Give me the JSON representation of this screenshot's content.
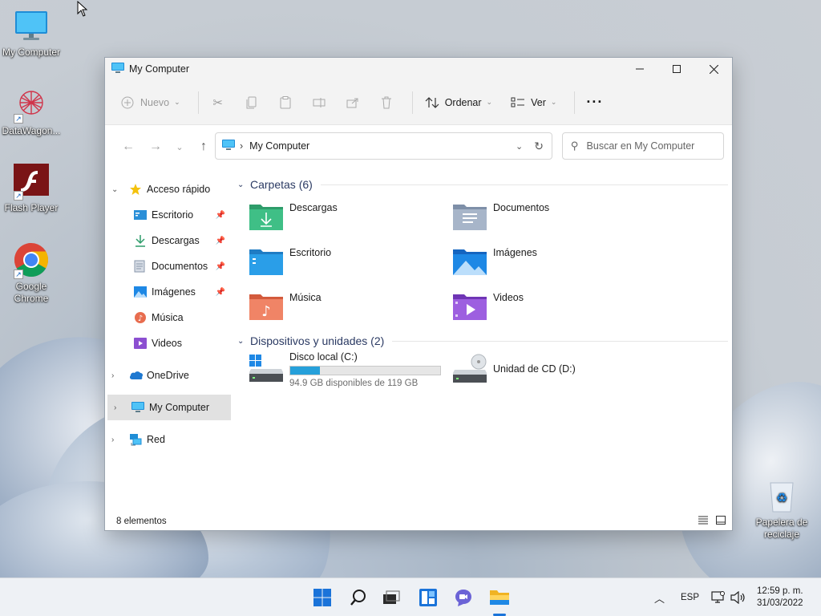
{
  "desktop": {
    "icons": [
      {
        "label": "My Computer",
        "icon": "monitor-icon"
      },
      {
        "label": "DataWagon...",
        "icon": "datawagon-icon"
      },
      {
        "label": "Flash Player",
        "icon": "flash-player-icon"
      },
      {
        "label": "Google Chrome",
        "icon": "chrome-icon"
      },
      {
        "label": "Papelera de reciclaje",
        "icon": "recycle-bin-icon"
      }
    ]
  },
  "window": {
    "title": "My Computer",
    "toolbar": {
      "new_label": "Nuevo",
      "sort_label": "Ordenar",
      "view_label": "Ver",
      "more_label": "···"
    },
    "address": {
      "path": "My Computer",
      "search_placeholder": "Buscar en My Computer"
    },
    "sidebar": {
      "quick_access": "Acceso rápido",
      "items": [
        {
          "label": "Escritorio",
          "icon": "desktop-folder-icon"
        },
        {
          "label": "Descargas",
          "icon": "download-icon"
        },
        {
          "label": "Documentos",
          "icon": "document-icon"
        },
        {
          "label": "Imágenes",
          "icon": "image-icon"
        },
        {
          "label": "Música",
          "icon": "music-icon"
        },
        {
          "label": "Videos",
          "icon": "video-icon"
        }
      ],
      "onedrive": "OneDrive",
      "this_pc": "My Computer",
      "network": "Red"
    },
    "folders_header": "Carpetas (6)",
    "folders": [
      {
        "label": "Descargas",
        "color": "#2e9c6a"
      },
      {
        "label": "Documentos",
        "color": "#7e8fa8"
      },
      {
        "label": "Escritorio",
        "color": "#2a8fd8"
      },
      {
        "label": "Imágenes",
        "color": "#1e88e5"
      },
      {
        "label": "Música",
        "color": "#e86d4f"
      },
      {
        "label": "Videos",
        "color": "#8c4fd1"
      }
    ],
    "devices_header": "Dispositivos y unidades (2)",
    "drives": [
      {
        "label": "Disco local (C:)",
        "free_text": "94.9 GB disponibles de 119 GB",
        "used_fraction": 0.2
      },
      {
        "label": "Unidad de CD (D:)"
      }
    ],
    "status": "8 elementos"
  },
  "taskbar": {
    "language": "ESP",
    "time": "12:59 p. m.",
    "date": "31/03/2022"
  }
}
